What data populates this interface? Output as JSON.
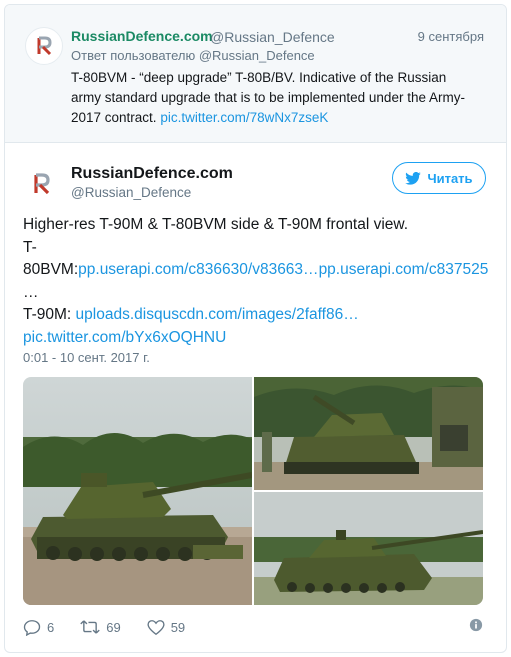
{
  "parent": {
    "name": "RussianDefence.com",
    "handle": "@Russian_Defence",
    "date": "9 сентября",
    "reply_to": "Ответ пользователю @Russian_Defence",
    "text_line1": "T-80BVM - “deep upgrade” T-80B/BV. Indicative of the Russian",
    "text_line2": "army standard upgrade that is to be implemented under the Army-",
    "text_line3": "2017 contract.",
    "link": "pic.twitter.com/78wNx7zseK"
  },
  "tweet": {
    "name": "RussianDefence.com",
    "handle": "@Russian_Defence",
    "follow_label": "Читать",
    "line1": "Higher-res T-90M & T-80BVM side & T-90M frontal view.",
    "line2": "T-",
    "line3_prefix": "80BVM:",
    "line3_link1": "pp.userapi.com/c836630/v83663…",
    "line3_link2": "pp.userapi.com/c837525",
    "line4": "…",
    "line5_prefix": "T-90M: ",
    "line5_link": "uploads.disquscdn.com/images/2faff86…",
    "line6_link": "pic.twitter.com/bYx6xOQHNU",
    "timestamp": "0:01 - 10 сент. 2017 г."
  },
  "actions": {
    "replies": "6",
    "retweets": "69",
    "likes": "59"
  },
  "icons": {
    "follow": "twitter-bird-icon",
    "reply": "reply-icon",
    "retweet": "retweet-icon",
    "like": "heart-icon",
    "info": "info-icon"
  },
  "colors": {
    "brand_name": "#1b8a64",
    "link": "#1b95e0",
    "follow": "#1da1f2",
    "muted": "#657786"
  }
}
